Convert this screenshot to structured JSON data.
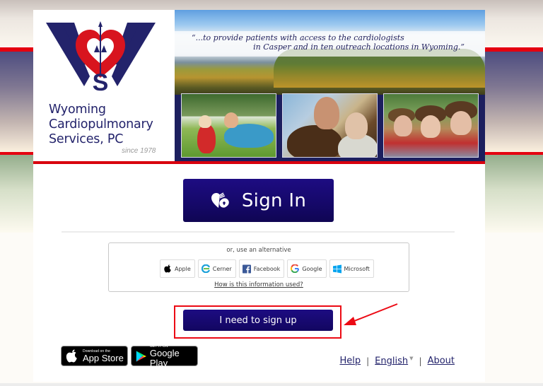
{
  "organization": {
    "name_lines": [
      "Wyoming",
      "Cardiopulmonary",
      "Services, PC"
    ],
    "since": "since 1978"
  },
  "banner": {
    "quote_line1": "“...to provide patients with access to the cardiologists",
    "quote_line2": "in Casper and in ten outreach locations in Wyoming.”"
  },
  "signin": {
    "label": "Sign In",
    "icon": "heart-lock-icon"
  },
  "alternatives": {
    "title": "or, use an alternative",
    "providers": [
      {
        "label": "Apple",
        "icon": "apple-icon"
      },
      {
        "label": "Cerner",
        "icon": "cerner-icon"
      },
      {
        "label": "Facebook",
        "icon": "facebook-icon"
      },
      {
        "label": "Google",
        "icon": "google-icon"
      },
      {
        "label": "Microsoft",
        "icon": "microsoft-icon"
      }
    ],
    "info_link": "How is this information used?"
  },
  "signup": {
    "label": "I need to sign up"
  },
  "stores": {
    "app_store_small": "Download on the",
    "app_store_big": "App Store",
    "google_play_small": "GET IT ON",
    "google_play_big": "Google Play"
  },
  "footer": {
    "help": "Help",
    "language": "English",
    "about": "About",
    "separator": "|"
  },
  "colors": {
    "brand_navy": "#1d0c82",
    "brand_red": "#e4000f",
    "annotation_red": "#ec0a14"
  }
}
